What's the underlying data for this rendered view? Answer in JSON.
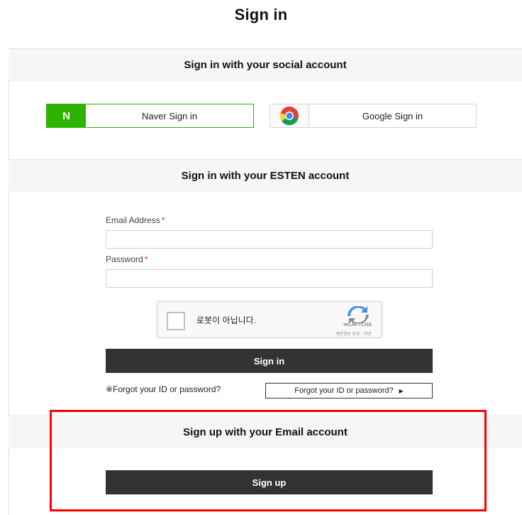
{
  "page": {
    "title": "Sign in"
  },
  "social": {
    "heading": "Sign in with your social account",
    "naver": {
      "logo_text": "N",
      "label": "Naver Sign in",
      "color": "#2db400"
    },
    "google": {
      "label": "Google Sign in",
      "icon": "chrome-google-icon"
    }
  },
  "account": {
    "heading": "Sign in with your ESTEN account",
    "email": {
      "label": "Email Address",
      "required_mark": "*",
      "value": "",
      "placeholder": ""
    },
    "password": {
      "label": "Password",
      "required_mark": "*",
      "value": "",
      "placeholder": ""
    },
    "captcha": {
      "text": "로봇이 아닙니다.",
      "brand": "reCAPTCHA",
      "links": "개인정보 보호 - 약관"
    },
    "signin_button": "Sign in",
    "forgot_note": "※Forgot your ID or password?",
    "forgot_button": "Forgot your ID or password?",
    "forgot_arrow": "▶"
  },
  "signup": {
    "heading": "Sign up with your Email account",
    "button": "Sign up"
  },
  "colors": {
    "dark_button": "#333333",
    "highlight": "#ff0000",
    "required": "#e02020"
  }
}
